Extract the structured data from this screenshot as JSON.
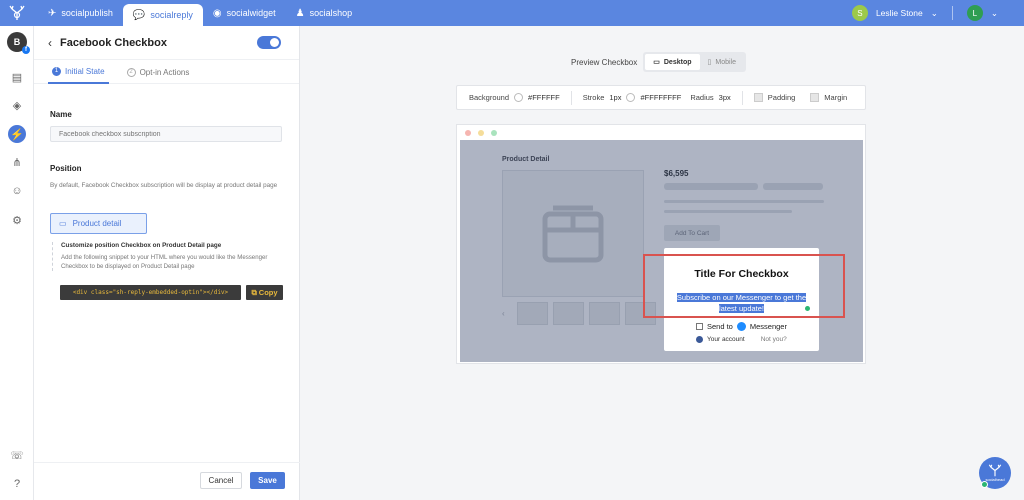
{
  "topbar": {
    "apps": [
      {
        "label": "socialpublish",
        "icon": "paper-plane-icon",
        "active": false
      },
      {
        "label": "socialreply",
        "icon": "chat-bubbles-icon",
        "active": true
      },
      {
        "label": "socialwidget",
        "icon": "widget-circle-icon",
        "active": false
      },
      {
        "label": "socialshop",
        "icon": "shop-bag-icon",
        "active": false
      }
    ],
    "user_name": "Leslie Stone",
    "user_initial": "L",
    "accent": "#5a86e0"
  },
  "rail": {
    "avatar_initial": "B",
    "items": [
      "inbox-icon",
      "layers-icon",
      "lightning-icon",
      "hierarchy-icon",
      "user-icon",
      "gear-icon",
      "support-icon",
      "help-icon"
    ]
  },
  "panel": {
    "title": "Facebook Checkbox",
    "toggle_on": true,
    "tabs": [
      {
        "num": "1",
        "label": "Initial State",
        "active": true
      },
      {
        "num": "2",
        "label": "Opt-in Actions",
        "active": false
      }
    ],
    "name_label": "Name",
    "name_placeholder": "Facebook checkbox subscription",
    "position_label": "Position",
    "position_desc": "By default, Facebook Checkbox subscription will be display at product detail page",
    "position_button": "Product detail",
    "customize_title": "Customize position Checkbox on Product Detail page",
    "customize_desc": "Add the following snippet to your HTML where you would like the Messenger Checkbox to be displayed on Product Detail page",
    "snippet": "<div class=\"sh-reply-embedded-optin\"></div>",
    "copy_label": "Copy",
    "cancel_label": "Cancel",
    "save_label": "Save"
  },
  "preview": {
    "label": "Preview Checkbox",
    "modes": [
      {
        "label": "Desktop",
        "active": true
      },
      {
        "label": "Mobile",
        "active": false
      }
    ],
    "style": {
      "background_label": "Background",
      "background_value": "#FFFFFF",
      "stroke_label": "Stroke",
      "stroke_width": "1px",
      "stroke_value": "#FFFFFFFF",
      "radius_label": "Radius",
      "radius_value": "3px",
      "padding_label": "Padding",
      "margin_label": "Margin"
    },
    "product": {
      "title": "Product Detail",
      "price": "$6,595",
      "add_to_cart": "Add To Cart"
    },
    "checkbox": {
      "title": "Title For Checkbox",
      "subtitle": "Subscribe on our Messenger to get the latest update!",
      "send_to": "Send to",
      "messenger": "Messenger",
      "your_account": "Your account",
      "not_you": "Not you?"
    }
  },
  "bottom_logo_text": "socialhead"
}
